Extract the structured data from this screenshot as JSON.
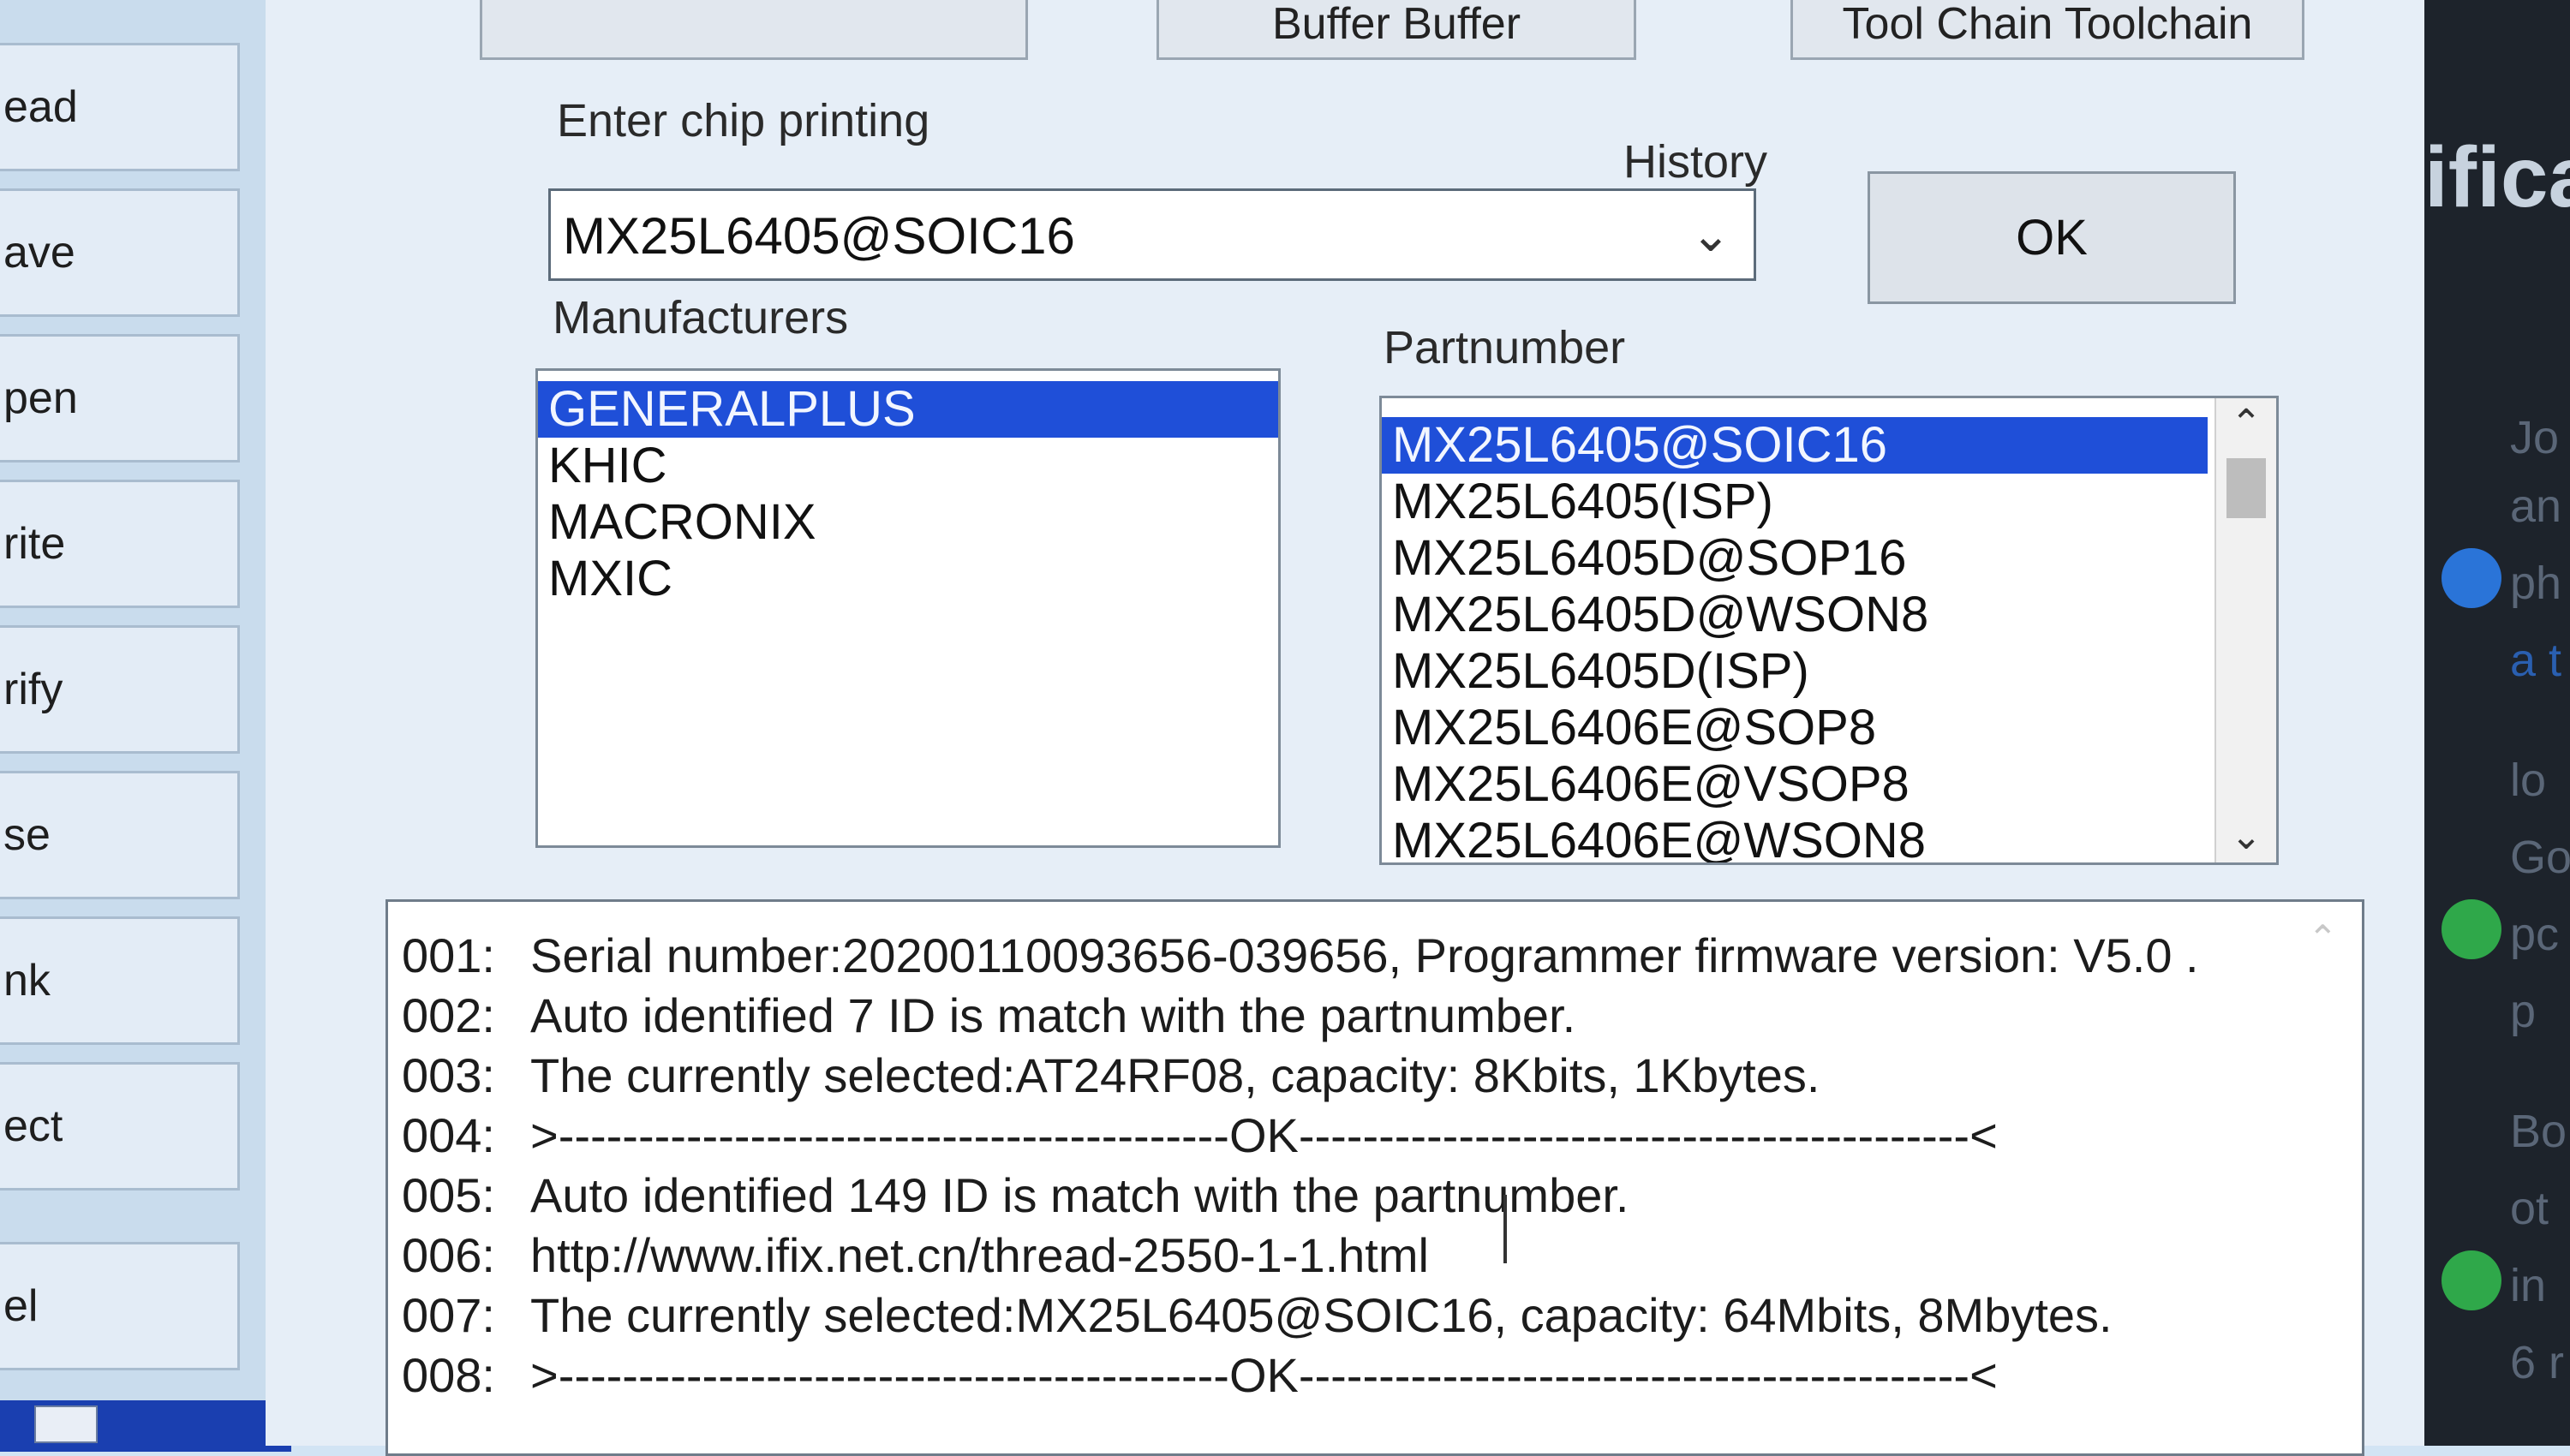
{
  "sidebar": {
    "buttons": [
      "ead",
      "ave",
      "pen",
      "rite",
      "rify",
      "se",
      "nk",
      "ect",
      "el"
    ]
  },
  "toolbar": {
    "buttons": [
      "",
      "Buffer Buffer",
      "Tool Chain Toolchain"
    ]
  },
  "chip_entry": {
    "label": "Enter chip printing",
    "history_label": "History",
    "value": "MX25L6405@SOIC16",
    "arrow": "⌄",
    "ok_label": "OK"
  },
  "manufacturers": {
    "label": "Manufacturers",
    "items": [
      "GENERALPLUS",
      "KHIC",
      "MACRONIX",
      "MXIC"
    ],
    "selected_index": 0
  },
  "partnumbers": {
    "label": "Partnumber",
    "items": [
      "MX25L6405@SOIC16",
      "MX25L6405(ISP)",
      "MX25L6405D@SOP16",
      "MX25L6405D@WSON8",
      "MX25L6405D(ISP)",
      "MX25L6406E@SOP8",
      "MX25L6406E@VSOP8",
      "MX25L6406E@WSON8"
    ],
    "selected_index": 0
  },
  "log": {
    "lines": [
      {
        "num": "001:",
        "text": "Serial number:20200110093656-039656, Programmer firmware version: V5.0 ."
      },
      {
        "num": "002:",
        "text": "Auto identified 7 ID is match with the partnumber."
      },
      {
        "num": "003:",
        "text": "The currently selected:AT24RF08, capacity: 8Kbits, 1Kbytes."
      },
      {
        "num": "004:",
        "text": ">------------------------------------------OK------------------------------------------<"
      },
      {
        "num": "005:",
        "text": "Auto identified 149 ID is match with the partnumber."
      },
      {
        "num": "006:",
        "text": "http://www.ifix.net.cn/thread-2550-1-1.html"
      },
      {
        "num": "007:",
        "text": "The currently selected:MX25L6405@SOIC16, capacity: 64Mbits, 8Mbytes."
      },
      {
        "num": "008:",
        "text": ">------------------------------------------OK------------------------------------------<"
      }
    ]
  },
  "right_edge": {
    "title_fragment": "ifica",
    "snippets": [
      "Jo",
      "an",
      "ph",
      "a t",
      "lo",
      "Go",
      "pc",
      "p",
      "Bo",
      "ot",
      "in",
      "6 r"
    ]
  }
}
